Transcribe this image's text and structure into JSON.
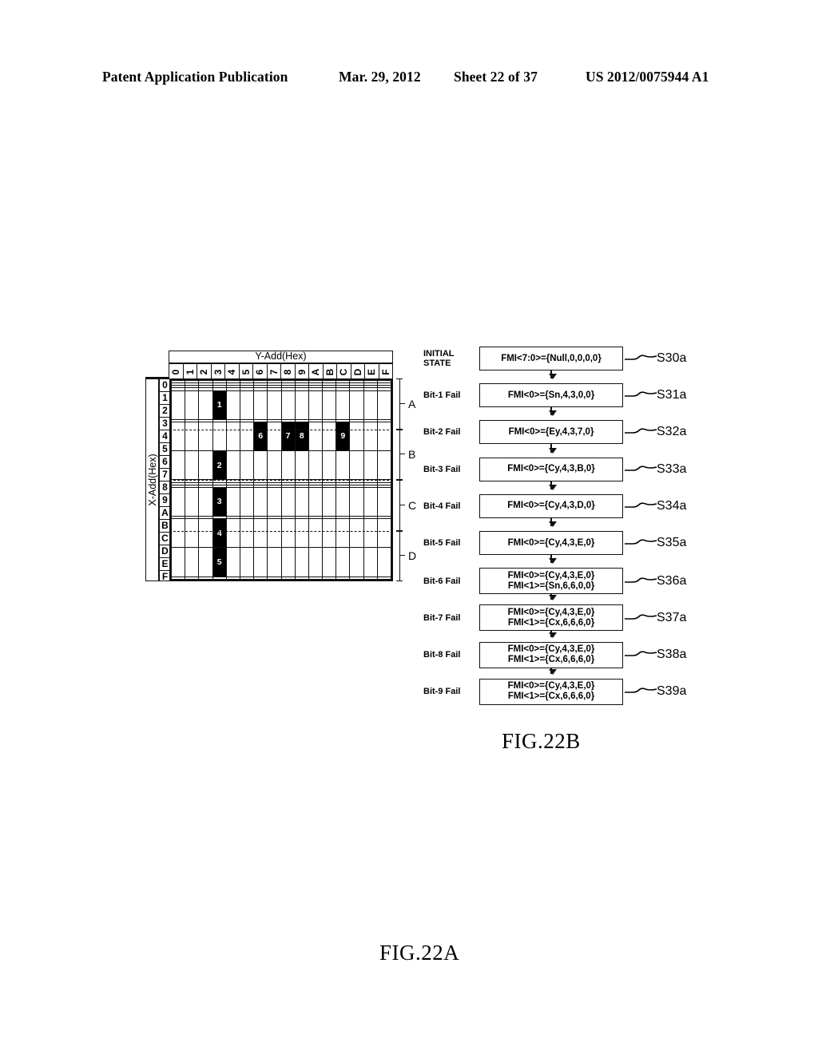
{
  "header": {
    "publication": "Patent Application Publication",
    "date": "Mar. 29, 2012",
    "sheet": "Sheet 22 of 37",
    "number": "US 2012/0075944 A1"
  },
  "fig22a": {
    "caption": "FIG.22A",
    "y_axis_title": "Y-Add(Hex)",
    "x_axis_title": "X-Add(Hex)",
    "columns": [
      "0",
      "1",
      "2",
      "3",
      "4",
      "5",
      "6",
      "7",
      "8",
      "9",
      "A",
      "B",
      "C",
      "D",
      "E",
      "F"
    ],
    "rows": [
      "0",
      "1",
      "2",
      "3",
      "4",
      "5",
      "6",
      "7",
      "8",
      "9",
      "A",
      "B",
      "C",
      "D",
      "E",
      "F"
    ],
    "marked_cells": [
      {
        "row": "4",
        "col": "3",
        "label": "1"
      },
      {
        "row": "6",
        "col": "6",
        "label": "6"
      },
      {
        "row": "6",
        "col": "8",
        "label": "7"
      },
      {
        "row": "6",
        "col": "9",
        "label": "8"
      },
      {
        "row": "6",
        "col": "C",
        "label": "9"
      },
      {
        "row": "7",
        "col": "3",
        "label": "2"
      },
      {
        "row": "B",
        "col": "3",
        "label": "3"
      },
      {
        "row": "D",
        "col": "3",
        "label": "4"
      },
      {
        "row": "E",
        "col": "3",
        "label": "5"
      }
    ],
    "block_separator_after_rows": [
      "3",
      "7",
      "B"
    ],
    "braces": [
      {
        "label": "A",
        "from_row": "0",
        "to_row": "3"
      },
      {
        "label": "B",
        "from_row": "4",
        "to_row": "7"
      },
      {
        "label": "C",
        "from_row": "8",
        "to_row": "B"
      },
      {
        "label": "D",
        "from_row": "C",
        "to_row": "F"
      }
    ]
  },
  "fig22b": {
    "caption": "FIG.22B",
    "steps": [
      {
        "stage": "INITIAL\nSTATE",
        "stage_lines": [
          "INITIAL",
          "STATE"
        ],
        "lines": [
          "FMI<7:0>={Null,0,0,0,0}"
        ],
        "ref": "S30a"
      },
      {
        "stage": "Bit-1 Fail",
        "stage_lines": [
          "Bit-1 Fail"
        ],
        "lines": [
          "FMI<0>={Sn,4,3,0,0}"
        ],
        "ref": "S31a"
      },
      {
        "stage": "Bit-2 Fail",
        "stage_lines": [
          "Bit-2 Fail"
        ],
        "lines": [
          "FMI<0>={Ey,4,3,7,0}"
        ],
        "ref": "S32a"
      },
      {
        "stage": "Bit-3 Fail",
        "stage_lines": [
          "Bit-3 Fail"
        ],
        "lines": [
          "FMI<0>={Cy,4,3,B,0}"
        ],
        "ref": "S33a"
      },
      {
        "stage": "Bit-4 Fail",
        "stage_lines": [
          "Bit-4 Fail"
        ],
        "lines": [
          "FMI<0>={Cy,4,3,D,0}"
        ],
        "ref": "S34a"
      },
      {
        "stage": "Bit-5 Fail",
        "stage_lines": [
          "Bit-5 Fail"
        ],
        "lines": [
          "FMI<0>={Cy,4,3,E,0}"
        ],
        "ref": "S35a"
      },
      {
        "stage": "Bit-6 Fail",
        "stage_lines": [
          "Bit-6 Fail"
        ],
        "lines": [
          "FMI<0>={Cy,4,3,E,0}",
          "FMI<1>={Sn,6,6,0,0}"
        ],
        "ref": "S36a"
      },
      {
        "stage": "Bit-7 Fail",
        "stage_lines": [
          "Bit-7 Fail"
        ],
        "lines": [
          "FMI<0>={Cy,4,3,E,0}",
          "FMI<1>={Cx,6,6,6,0}"
        ],
        "ref": "S37a"
      },
      {
        "stage": "Bit-8 Fail",
        "stage_lines": [
          "Bit-8 Fail"
        ],
        "lines": [
          "FMI<0>={Cy,4,3,E,0}",
          "FMI<1>={Cx,6,6,6,0}"
        ],
        "ref": "S38a"
      },
      {
        "stage": "Bit-9 Fail",
        "stage_lines": [
          "Bit-9 Fail"
        ],
        "lines": [
          "FMI<0>={Cy,4,3,E,0}",
          "FMI<1>={Cx,6,6,6,0}"
        ],
        "ref": "S39a"
      }
    ]
  },
  "colors": {
    "ink": "#000000",
    "paper": "#ffffff",
    "marked_cell_bg": "#000000",
    "marked_cell_fg": "#ffffff"
  }
}
